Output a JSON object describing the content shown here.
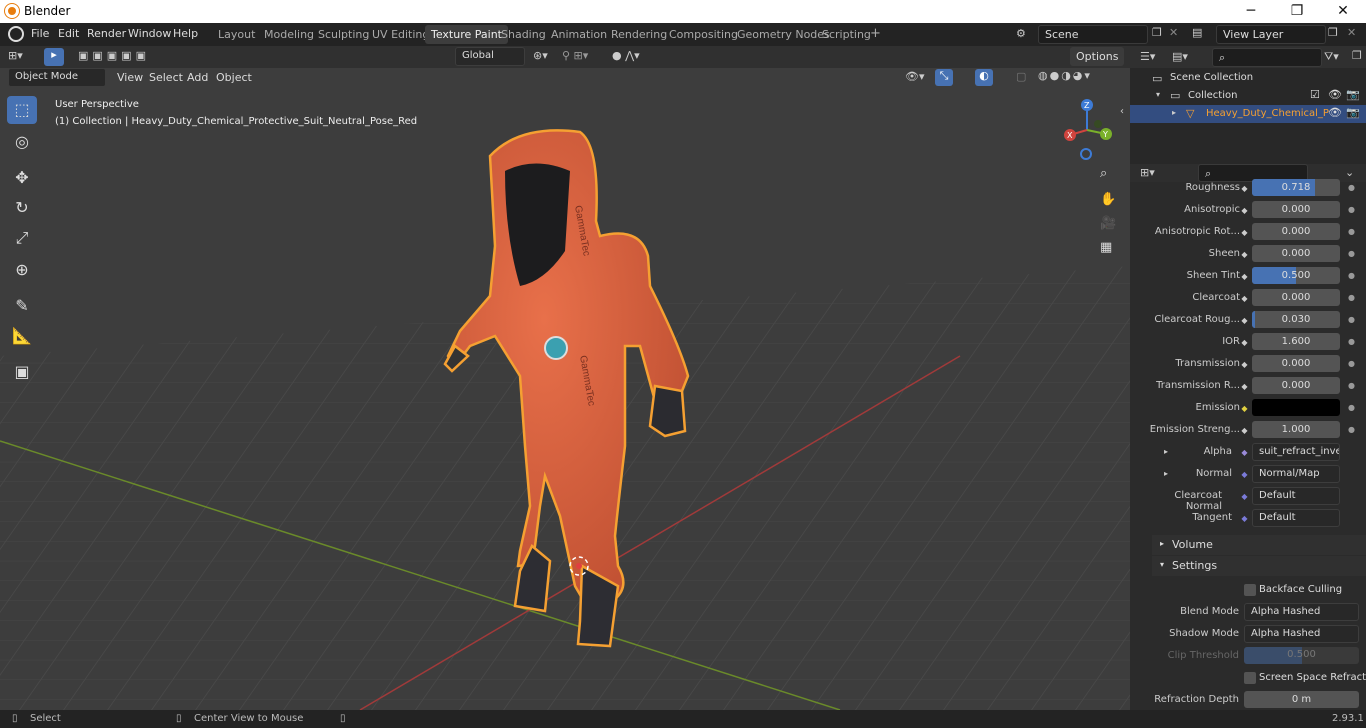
{
  "window": {
    "title": "Blender",
    "min": "─",
    "max": "❐",
    "close": "✕"
  },
  "menu": [
    "File",
    "Edit",
    "Render",
    "Window",
    "Help"
  ],
  "workspaces": [
    "Layout",
    "Modeling",
    "Sculpting",
    "UV Editing",
    "Texture Paint",
    "Shading",
    "Animation",
    "Rendering",
    "Compositing",
    "Geometry Nodes",
    "Scripting"
  ],
  "active_workspace": "Texture Paint",
  "scene": {
    "label": "Scene",
    "viewlayer": "View Layer"
  },
  "header": {
    "transform": "Global",
    "options": "Options",
    "mode": "Object Mode",
    "view": "View",
    "select": "Select",
    "add": "Add",
    "object": "Object"
  },
  "viewport": {
    "perspective": "User Perspective",
    "collection_info": "(1) Collection | Heavy_Duty_Chemical_Protective_Suit_Neutral_Pose_Red",
    "logo": "GammaTec"
  },
  "outliner": {
    "scene_collection": "Scene Collection",
    "collection": "Collection",
    "object": "Heavy_Duty_Chemical_P"
  },
  "properties": [
    {
      "label": "Roughness",
      "value": "0.718",
      "fill": 0.718
    },
    {
      "label": "Anisotropic",
      "value": "0.000",
      "fill": 0
    },
    {
      "label": "Anisotropic Rot...",
      "value": "0.000",
      "fill": 0
    },
    {
      "label": "Sheen",
      "value": "0.000",
      "fill": 0
    },
    {
      "label": "Sheen Tint",
      "value": "0.500",
      "fill": 0.5
    },
    {
      "label": "Clearcoat",
      "value": "0.000",
      "fill": 0
    },
    {
      "label": "Clearcoat Roug...",
      "value": "0.030",
      "fill": 0.03
    },
    {
      "label": "IOR",
      "value": "1.600",
      "fill": 0
    },
    {
      "label": "Transmission",
      "value": "0.000",
      "fill": 0
    },
    {
      "label": "Transmission R...",
      "value": "0.000",
      "fill": 0
    },
    {
      "label": "Emission",
      "value": "",
      "fill": 0
    },
    {
      "label": "Emission Streng...",
      "value": "1.000",
      "fill": 0
    }
  ],
  "links": [
    {
      "label": "Alpha",
      "value": "suit_refract_invert.pn"
    },
    {
      "label": "Normal",
      "value": "Normal/Map"
    },
    {
      "label": "Clearcoat Normal",
      "value": "Default"
    },
    {
      "label": "Tangent",
      "value": "Default"
    }
  ],
  "sections": {
    "volume": "Volume",
    "settings": "Settings"
  },
  "settings": {
    "backface": "Backface Culling",
    "blend_label": "Blend Mode",
    "blend": "Alpha Hashed",
    "shadow_label": "Shadow Mode",
    "shadow": "Alpha Hashed",
    "clip_label": "Clip Threshold",
    "clip": "0.500",
    "ssr": "Screen Space Refraction",
    "refr_label": "Refraction Depth",
    "refr": "0 m"
  },
  "status": {
    "select": "Select",
    "center": "Center View to Mouse",
    "version": "2.93.1"
  },
  "colors": {
    "accent": "#4772b3",
    "selection": "#f5a032",
    "suit": "#d9603e"
  }
}
